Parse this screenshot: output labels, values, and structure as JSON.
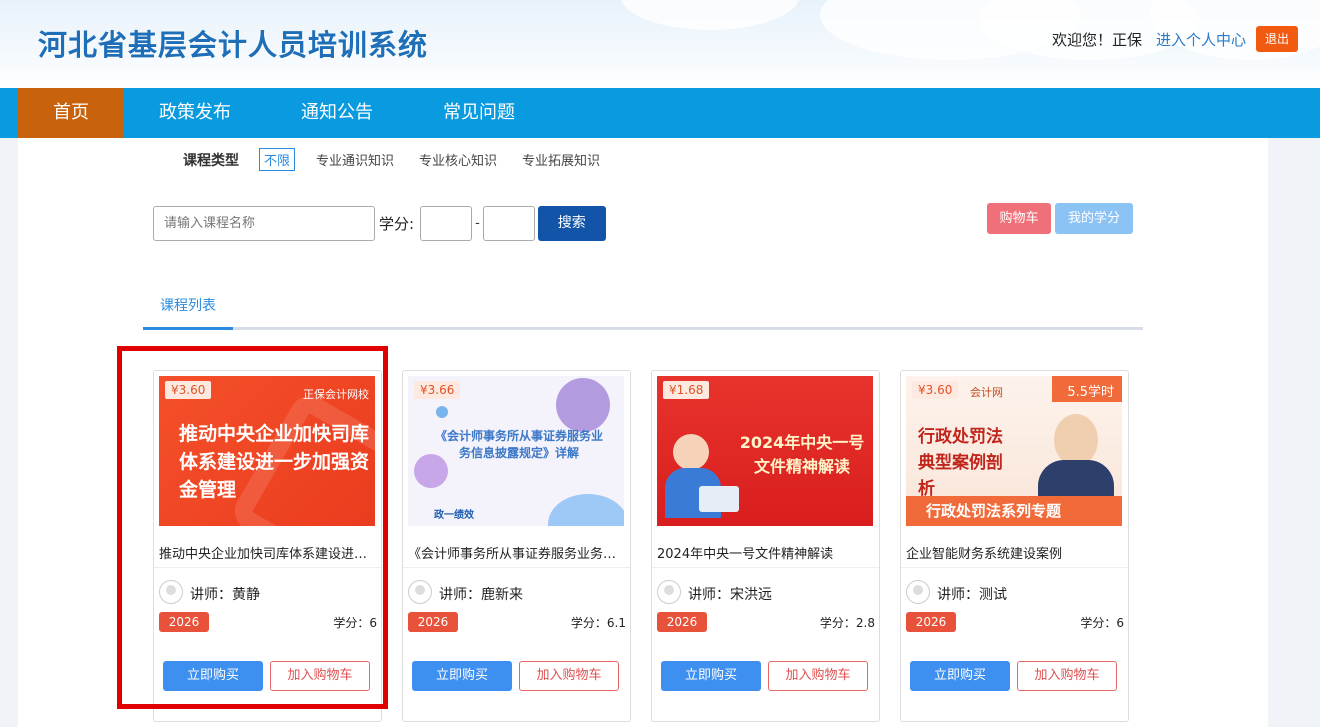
{
  "header": {
    "site_title": "河北省基层会计人员培训系统",
    "welcome": "欢迎您！正保",
    "user_center": "进入个人中心",
    "logout": "退出"
  },
  "nav": {
    "items": [
      {
        "label": "首页"
      },
      {
        "label": "政策发布"
      },
      {
        "label": "通知公告"
      },
      {
        "label": "常见问题"
      }
    ]
  },
  "filter": {
    "label": "课程类型",
    "options": [
      "不限",
      "专业通识知识",
      "专业核心知识",
      "专业拓展知识"
    ]
  },
  "search": {
    "placeholder": "请输入课程名称",
    "credit_label": "学分:",
    "dash": "-",
    "button": "搜索"
  },
  "actions": {
    "cart": "购物车",
    "my_credit": "我的学分"
  },
  "tab": {
    "label": "课程列表"
  },
  "courses": [
    {
      "price": "¥3.60",
      "title": "推动中央企业加快司库体系建设进一步加强资金管理",
      "thumb_text": "推动中央企业加快司库体系建设进一步加强资金管理",
      "thumb_brand": "正保会计网校",
      "teacher": "讲师：黄静",
      "year": "2026",
      "credit": "学分：6",
      "buy": "立即购买",
      "add": "加入购物车"
    },
    {
      "price": "¥3.66",
      "title": "《会计师事务所从事证券服务业务信息披露规定》详解",
      "thumb_text": "《会计师事务所从事证券服务业务信息披露规定》详解",
      "thumb_brand": "政一绩效",
      "teacher": "讲师：鹿新来",
      "year": "2026",
      "credit": "学分：6.1",
      "buy": "立即购买",
      "add": "加入购物车"
    },
    {
      "price": "¥1.68",
      "title": "2024年中央一号文件精神解读",
      "thumb_text": "2024年中央一号文件精神解读",
      "teacher": "讲师：宋洪远",
      "year": "2026",
      "credit": "学分：2.8",
      "buy": "立即购买",
      "add": "加入购物车"
    },
    {
      "price": "¥3.60",
      "title": "企业智能财务系统建设案例",
      "thumb_text": "行政处罚法典型案例剖析",
      "thumb_sub": "行政处罚法系列专题",
      "thumb_hours": "5.5学时",
      "thumb_brand": "会计网",
      "teacher": "讲师：测试",
      "year": "2026",
      "credit": "学分：6",
      "buy": "立即购买",
      "add": "加入购物车"
    }
  ],
  "colors": {
    "nav": "#0a9ae0",
    "nav_active": "#c9620d",
    "highlight": "#e00000"
  }
}
